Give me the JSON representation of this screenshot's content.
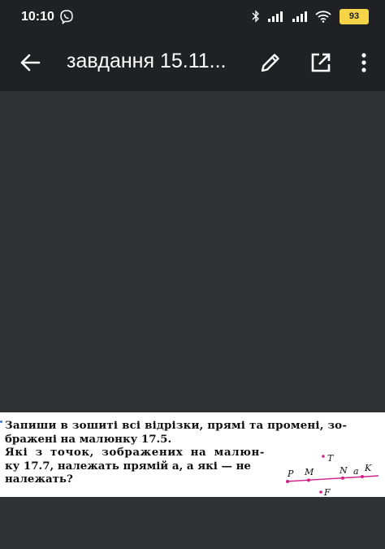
{
  "status_bar": {
    "time": "10:10",
    "battery": "93",
    "icons": [
      "viber-icon",
      "bluetooth-icon",
      "signal-icon",
      "signal-icon",
      "wifi-icon",
      "battery-icon"
    ]
  },
  "app_bar": {
    "title": "завдання 15.11...",
    "actions": [
      "back-arrow-icon",
      "edit-pencil-icon",
      "open-external-icon",
      "more-vert-icon"
    ]
  },
  "document": {
    "lines": [
      "Запиши в зошиті всі відрізки, прямі та промені, зо-",
      "бражені на малюнку 17.5.",
      "Які з точок, зображених на малюн-",
      "ку 17.7, належать прямій a, а які — не",
      "належать?"
    ],
    "figure": {
      "labels": [
        "T",
        "P",
        "M",
        "N",
        "a",
        "K",
        "F"
      ],
      "point_color": "#d0208a"
    }
  }
}
